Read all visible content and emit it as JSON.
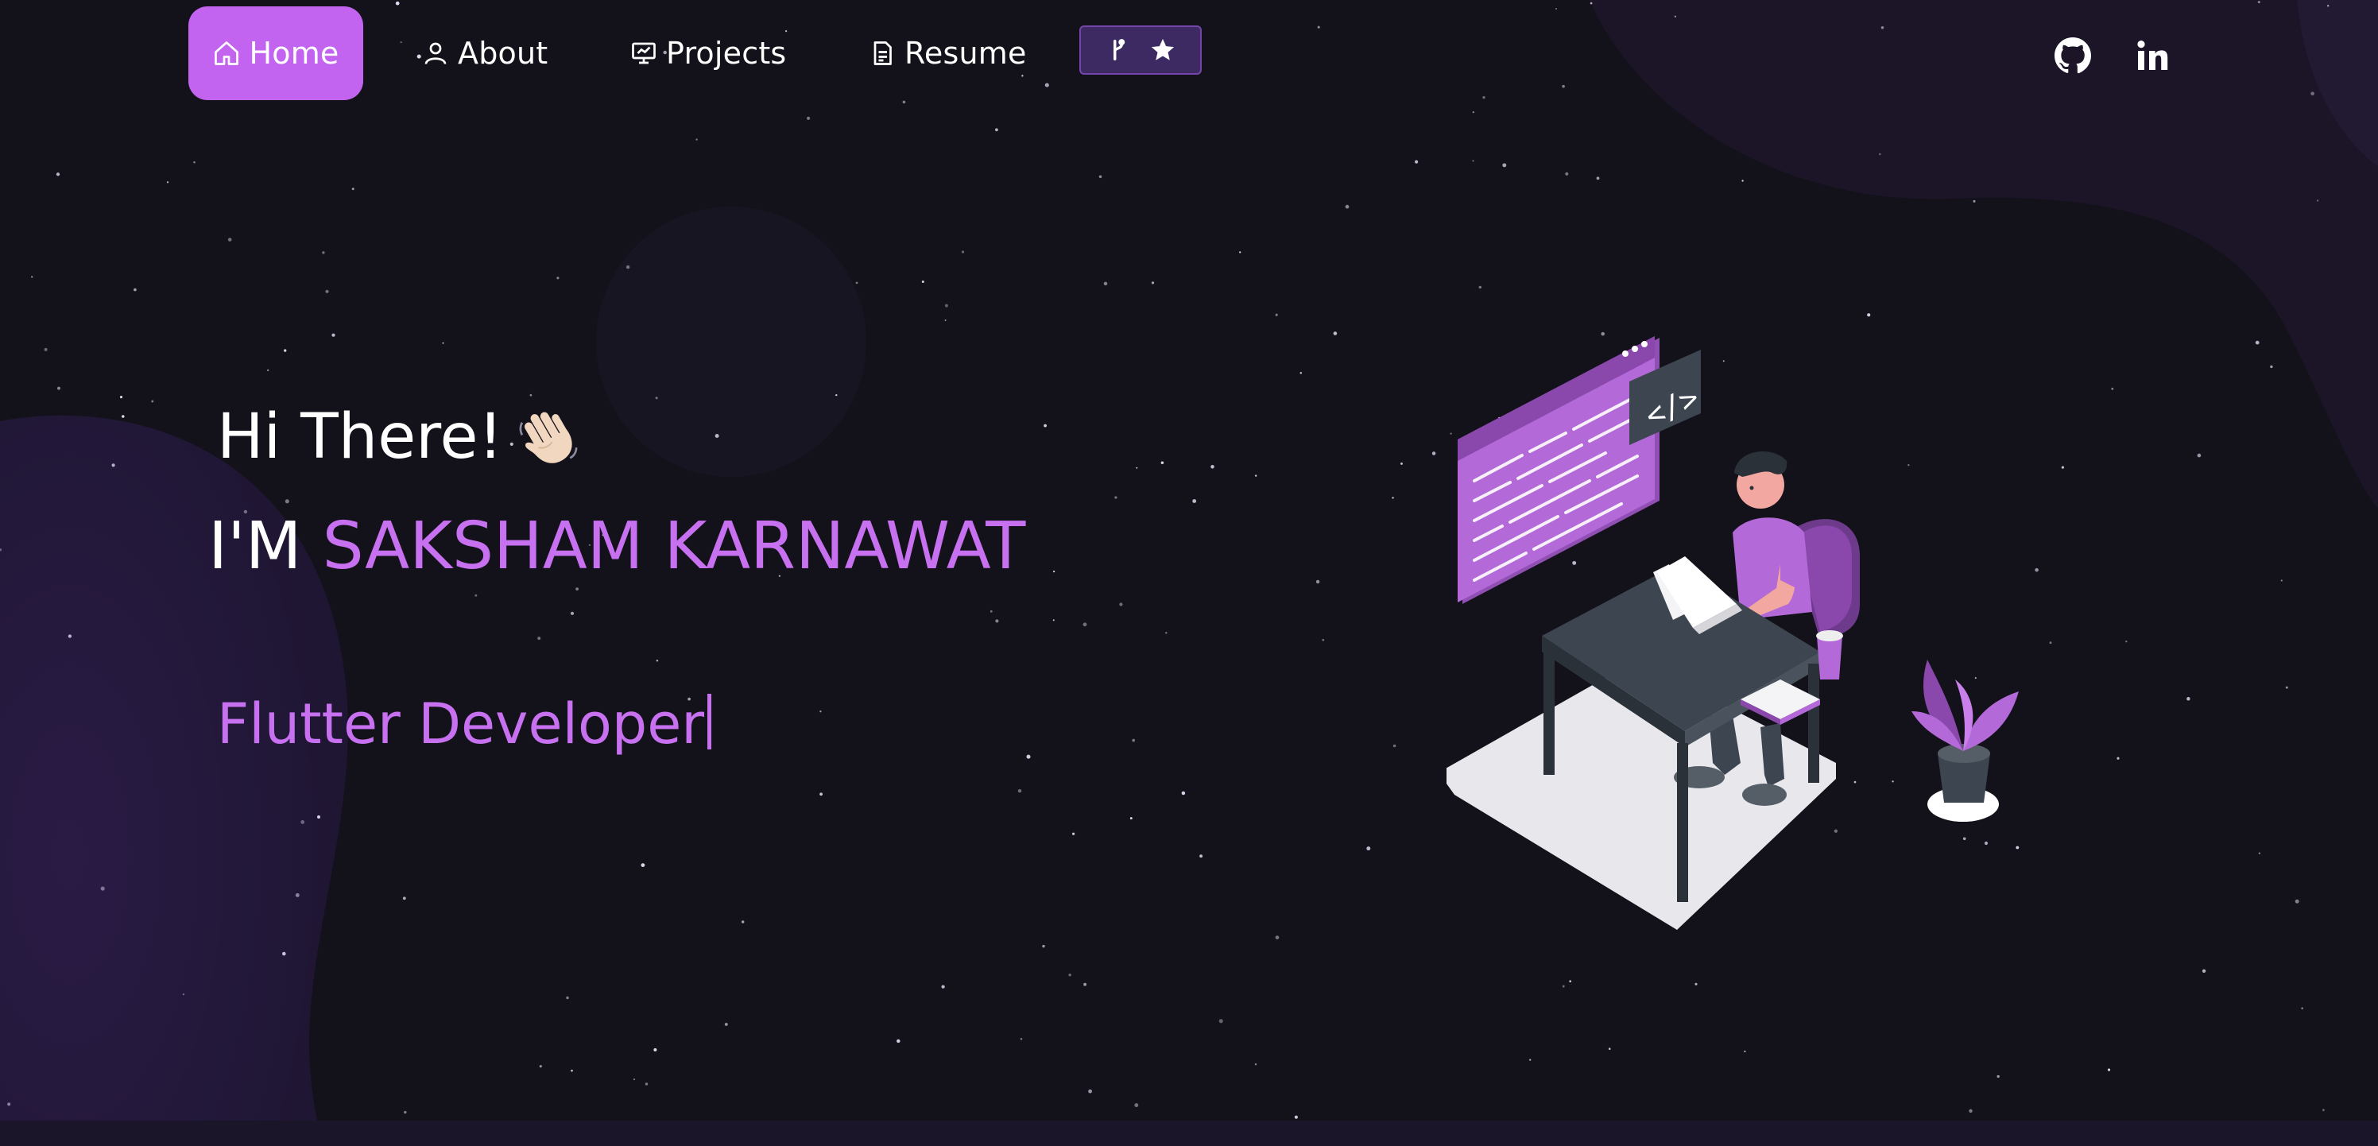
{
  "nav": {
    "items": [
      {
        "label": "Home",
        "icon": "home-icon",
        "active": true
      },
      {
        "label": "About",
        "icon": "user-icon"
      },
      {
        "label": "Projects",
        "icon": "projects-icon"
      },
      {
        "label": "Resume",
        "icon": "document-icon"
      }
    ],
    "fork_button_icons": [
      "git-fork-icon",
      "star-icon"
    ],
    "social": [
      "github-icon",
      "linkedin-icon"
    ]
  },
  "hero": {
    "greeting": "Hi There!",
    "greeting_emoji": "waving-hand-icon",
    "intro_prefix": "I'M",
    "name": "SAKSHAM KARNAWAT",
    "typed_text": "Flutter Developer"
  },
  "theme": {
    "background": "#13121a",
    "accent": "#c770f0",
    "active_nav": "#c264f0",
    "fork_button_bg": "#3e2a63"
  }
}
